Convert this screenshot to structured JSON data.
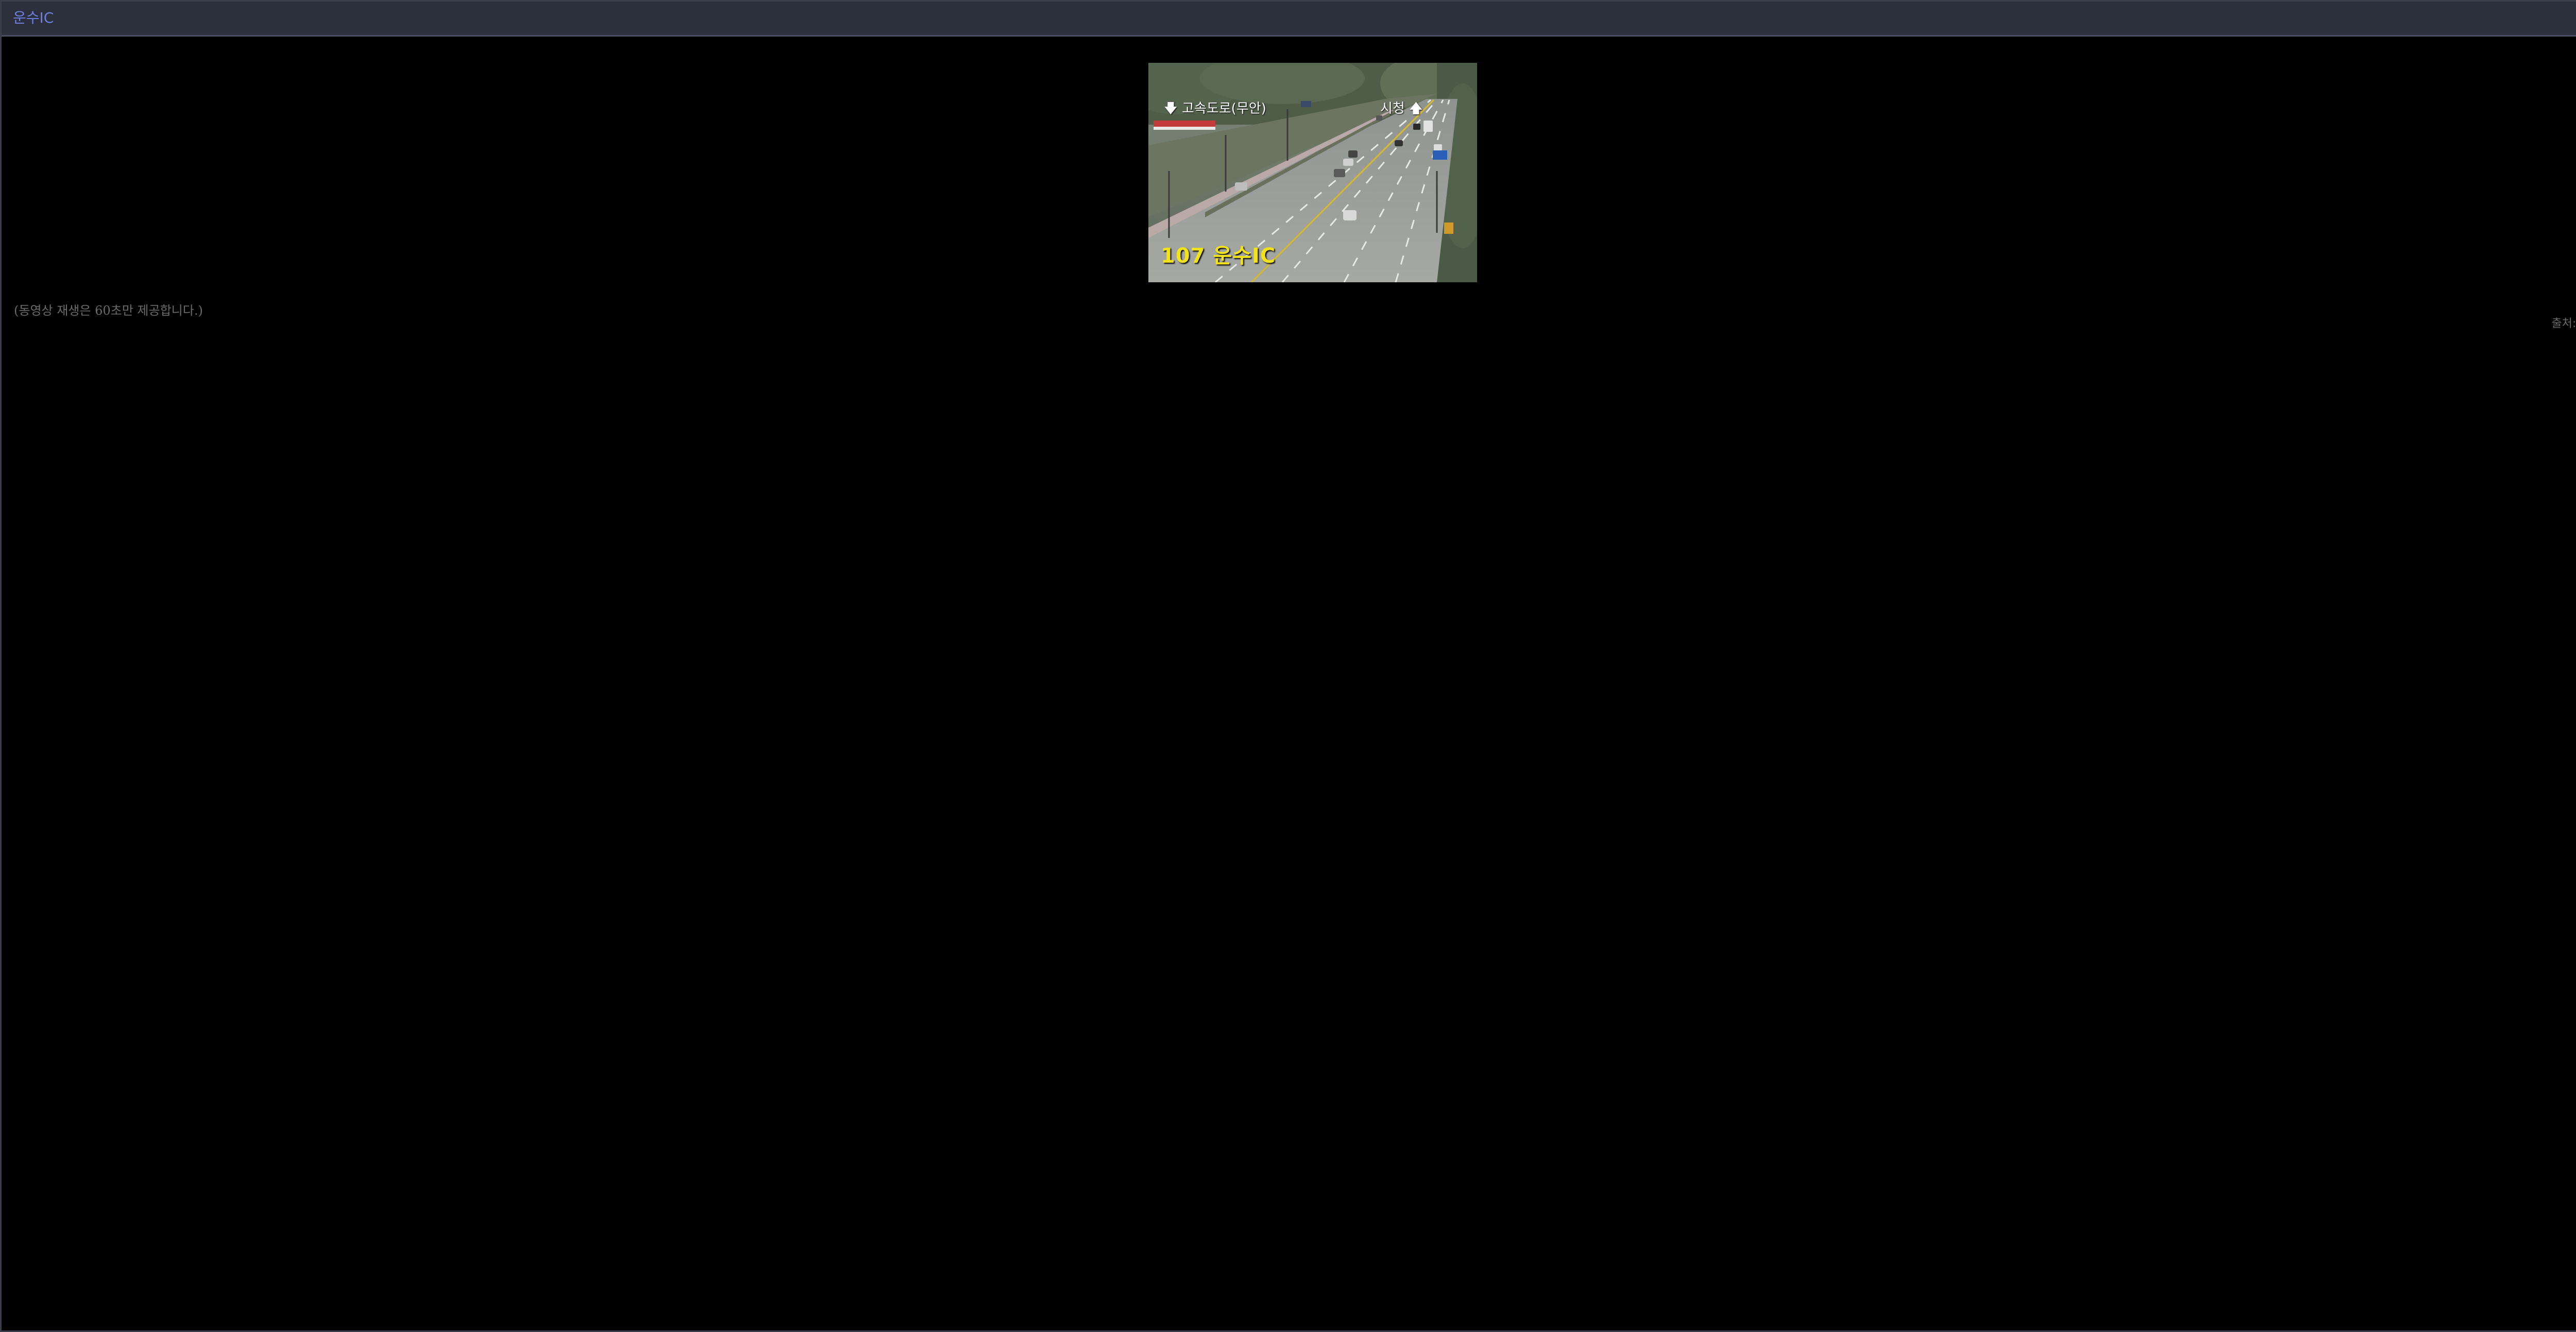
{
  "window": {
    "title": "운수IC",
    "close_icon": "close-icon"
  },
  "cctv": {
    "direction_left": "고속도로(무안)",
    "direction_right": "시청",
    "station_label": "107 운수IC",
    "left_arrow_icon": "arrow-down-icon",
    "right_arrow_icon": "arrow-up-icon"
  },
  "notice": "(동영상 재생은 60초만 제공합니다.)",
  "source": "출처:광역시",
  "colors": {
    "title_text": "#6f7fe0",
    "titlebar_bg": "#2c2f3c",
    "background": "#000000",
    "station_text": "#f2e21a",
    "notice_text": "#6a6a6a"
  }
}
